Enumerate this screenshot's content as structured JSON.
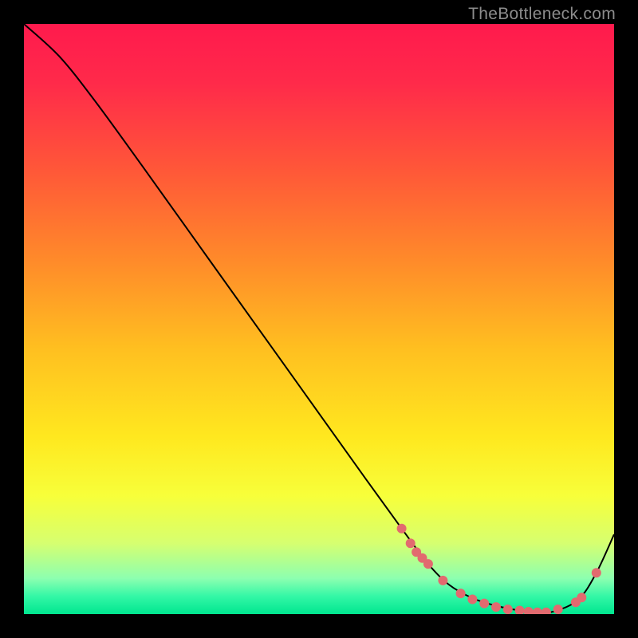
{
  "watermark": "TheBottleneck.com",
  "colors": {
    "gradient_stops": [
      {
        "offset": 0.0,
        "color": "#ff1a4d"
      },
      {
        "offset": 0.1,
        "color": "#ff2a4a"
      },
      {
        "offset": 0.25,
        "color": "#ff5838"
      },
      {
        "offset": 0.4,
        "color": "#ff8a2a"
      },
      {
        "offset": 0.55,
        "color": "#ffbf20"
      },
      {
        "offset": 0.7,
        "color": "#ffe81f"
      },
      {
        "offset": 0.8,
        "color": "#f7ff3a"
      },
      {
        "offset": 0.88,
        "color": "#d6ff70"
      },
      {
        "offset": 0.94,
        "color": "#8cffb0"
      },
      {
        "offset": 0.97,
        "color": "#33f7a6"
      },
      {
        "offset": 1.0,
        "color": "#00e690"
      }
    ],
    "curve": "#000000",
    "marker": "#e26a6f"
  },
  "chart_data": {
    "type": "line",
    "title": "",
    "xlabel": "",
    "ylabel": "",
    "xlim": [
      0,
      1
    ],
    "ylim": [
      0,
      1
    ],
    "series": [
      {
        "name": "curve",
        "x": [
          0.0,
          0.06,
          0.12,
          0.2,
          0.3,
          0.4,
          0.5,
          0.58,
          0.64,
          0.685,
          0.72,
          0.76,
          0.8,
          0.84,
          0.87,
          0.9,
          0.94,
          0.97,
          1.0
        ],
        "y": [
          1.0,
          0.945,
          0.87,
          0.76,
          0.62,
          0.48,
          0.34,
          0.228,
          0.145,
          0.085,
          0.05,
          0.027,
          0.014,
          0.006,
          0.003,
          0.005,
          0.025,
          0.07,
          0.135
        ]
      }
    ],
    "markers": [
      {
        "x": 0.64,
        "y": 0.145
      },
      {
        "x": 0.655,
        "y": 0.12
      },
      {
        "x": 0.665,
        "y": 0.105
      },
      {
        "x": 0.675,
        "y": 0.095
      },
      {
        "x": 0.685,
        "y": 0.085
      },
      {
        "x": 0.71,
        "y": 0.057
      },
      {
        "x": 0.74,
        "y": 0.035
      },
      {
        "x": 0.76,
        "y": 0.025
      },
      {
        "x": 0.78,
        "y": 0.018
      },
      {
        "x": 0.8,
        "y": 0.012
      },
      {
        "x": 0.82,
        "y": 0.008
      },
      {
        "x": 0.84,
        "y": 0.006
      },
      {
        "x": 0.855,
        "y": 0.004
      },
      {
        "x": 0.87,
        "y": 0.003
      },
      {
        "x": 0.885,
        "y": 0.003
      },
      {
        "x": 0.905,
        "y": 0.008
      },
      {
        "x": 0.935,
        "y": 0.02
      },
      {
        "x": 0.945,
        "y": 0.028
      },
      {
        "x": 0.97,
        "y": 0.07
      }
    ]
  }
}
